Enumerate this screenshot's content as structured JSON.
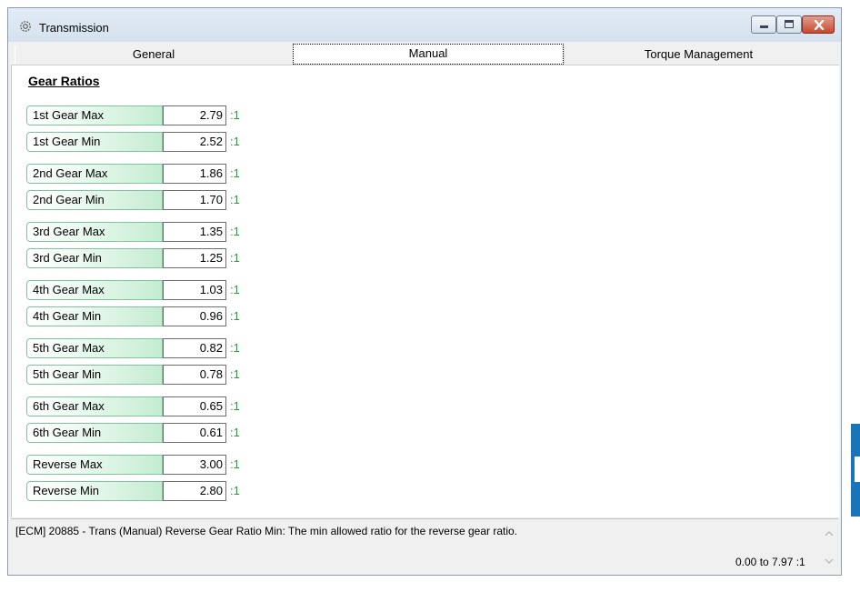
{
  "window": {
    "title": "Transmission",
    "icon": "gear-icon"
  },
  "tabs": [
    {
      "label": "General",
      "active": false
    },
    {
      "label": "Manual",
      "active": true
    },
    {
      "label": "Torque Management",
      "active": false
    }
  ],
  "section": {
    "title": "Gear Ratios",
    "unit": ":1"
  },
  "rows": [
    {
      "label": "1st Gear Max",
      "value": "2.79"
    },
    {
      "label": "1st Gear Min",
      "value": "2.52"
    },
    {
      "label": "2nd Gear Max",
      "value": "1.86"
    },
    {
      "label": "2nd Gear Min",
      "value": "1.70"
    },
    {
      "label": "3rd Gear Max",
      "value": "1.35"
    },
    {
      "label": "3rd Gear Min",
      "value": "1.25"
    },
    {
      "label": "4th Gear Max",
      "value": "1.03"
    },
    {
      "label": "4th Gear Min",
      "value": "0.96"
    },
    {
      "label": "5th Gear Max",
      "value": "0.82"
    },
    {
      "label": "5th Gear Min",
      "value": "0.78"
    },
    {
      "label": "6th Gear Max",
      "value": "0.65"
    },
    {
      "label": "6th Gear Min",
      "value": "0.61"
    },
    {
      "label": "Reverse Max",
      "value": "3.00"
    },
    {
      "label": "Reverse Min",
      "value": "2.80"
    }
  ],
  "status": {
    "description": "[ECM] 20885 - Trans (Manual) Reverse Gear Ratio Min: The min allowed ratio for the reverse gear ratio.",
    "range": "0.00 to 7.97 :1"
  },
  "colors": {
    "label_border": "#7fc49a",
    "label_gradient_end": "#c5ecd2",
    "unit_text": "#2b9a3c",
    "close_button": "#c9482d"
  }
}
